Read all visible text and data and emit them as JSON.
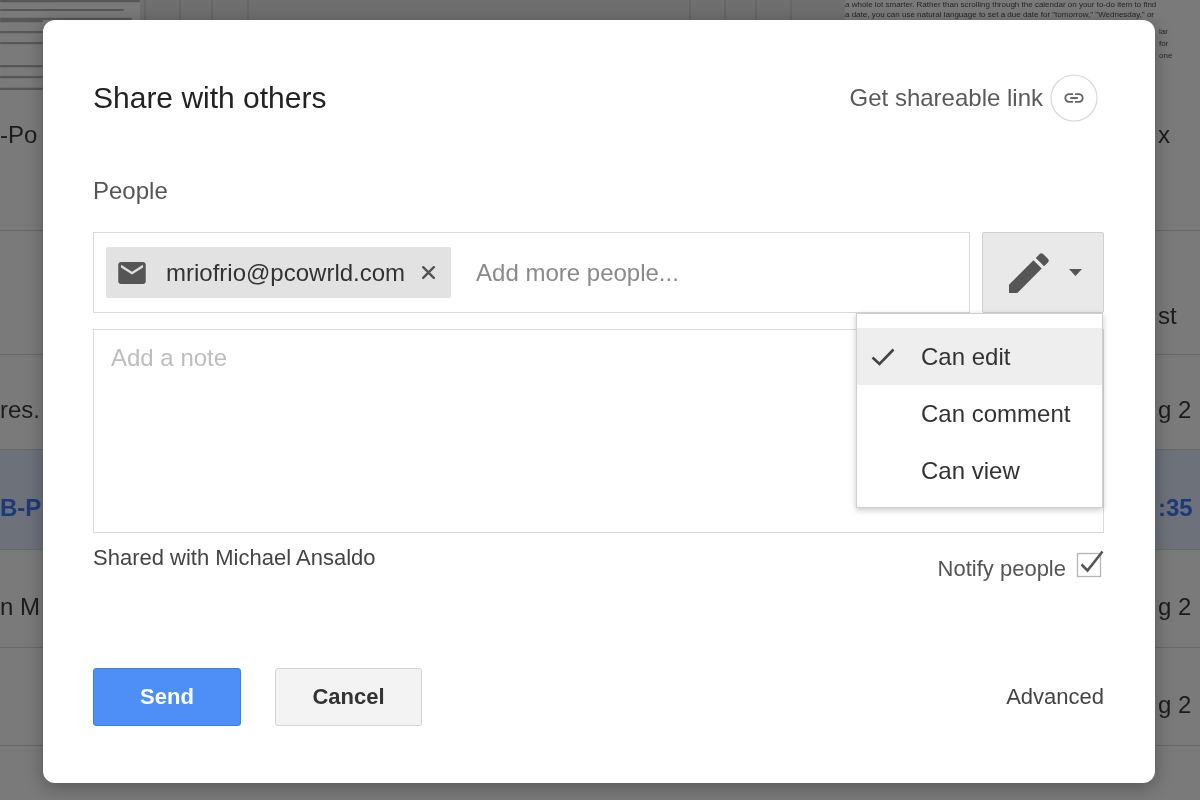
{
  "page": {
    "header_text": [
      "a whole lot smarter. Rather than scrolling through the calendar on your to-do item to find",
      "a date, you can use natural language to set a due date for \"tomorrow,\" \"Wednesday,\" or"
    ],
    "side_fragments": [
      "lar",
      "for",
      "one"
    ],
    "rows": [
      {
        "column_1": "-Po",
        "column_2": "x",
        "selected": false
      },
      {
        "column_2": "st",
        "selected": false
      },
      {
        "column_1": "res.",
        "column_2": "g 2",
        "selected": false
      },
      {
        "column_1": "B-P",
        "column_2": ":35",
        "selected": true
      },
      {
        "column_1": "n M",
        "column_2": "g 2",
        "selected": false
      },
      {
        "column_2": "g 2",
        "selected": false
      }
    ]
  },
  "dialog": {
    "title": "Share with others",
    "shareable_link": "Get shareable link",
    "people_label": "People",
    "recipients": [
      {
        "email": "mriofrio@pcowrld.com"
      }
    ],
    "add_people": {
      "placeholder": "Add more people..."
    },
    "permission_menu": {
      "expanded": true,
      "options": [
        {
          "label": "Can edit",
          "selected": true
        },
        {
          "label": "Can comment",
          "selected": false
        },
        {
          "label": "Can view",
          "selected": false
        }
      ]
    },
    "note": {
      "placeholder": "Add a note"
    },
    "shared_with": "Shared with Michael Ansaldo",
    "notify": {
      "label": "Notify people",
      "checked": true
    },
    "buttons": [
      {
        "label": "Send",
        "kind": "primary"
      },
      {
        "label": "Cancel",
        "kind": "secondary"
      }
    ],
    "advanced": "Advanced"
  }
}
